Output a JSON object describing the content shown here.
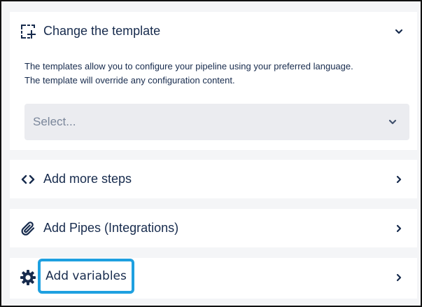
{
  "template_section": {
    "title": "Change the template",
    "description_line1": "The templates allow you to configure your pipeline using your preferred language.",
    "description_line2": "The template will override any configuration content.",
    "select_placeholder": "Select..."
  },
  "steps_section": {
    "title": "Add more steps"
  },
  "pipes_section": {
    "title": "Add Pipes (Integrations)"
  },
  "variables_section": {
    "title": "Add variables"
  },
  "colors": {
    "text": "#172b4d",
    "placeholder": "#7a869a",
    "select_bg": "#ebecf0",
    "panel_bg": "#f4f5f7",
    "highlight_border": "#1ea0e0"
  },
  "icons": {
    "template": "template-add-icon",
    "steps": "code-icon",
    "pipes": "paperclip-icon",
    "variables": "gear-icon",
    "collapse": "chevron-down-icon",
    "expand": "chevron-right-icon"
  }
}
